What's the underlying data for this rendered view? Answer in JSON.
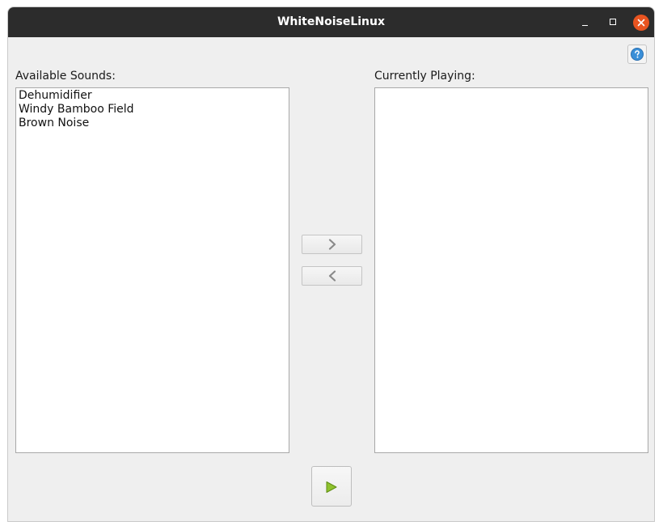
{
  "window": {
    "title": "WhiteNoiseLinux"
  },
  "titlebar_buttons": {
    "minimize_icon": "minimize-icon",
    "maximize_icon": "maximize-icon",
    "close_icon": "close-icon",
    "close_color": "#e95420"
  },
  "help": {
    "icon": "help-icon",
    "icon_color": "#3a8fd8"
  },
  "available": {
    "label": "Available Sounds:",
    "items": [
      "Dehumidifier",
      "Windy Bamboo Field",
      "Brown Noise"
    ]
  },
  "playing": {
    "label": "Currently Playing:",
    "items": []
  },
  "controls": {
    "add_icon": "chevron-right-icon",
    "remove_icon": "chevron-left-icon",
    "play_icon": "play-icon",
    "play_color": "#8fc22d"
  }
}
